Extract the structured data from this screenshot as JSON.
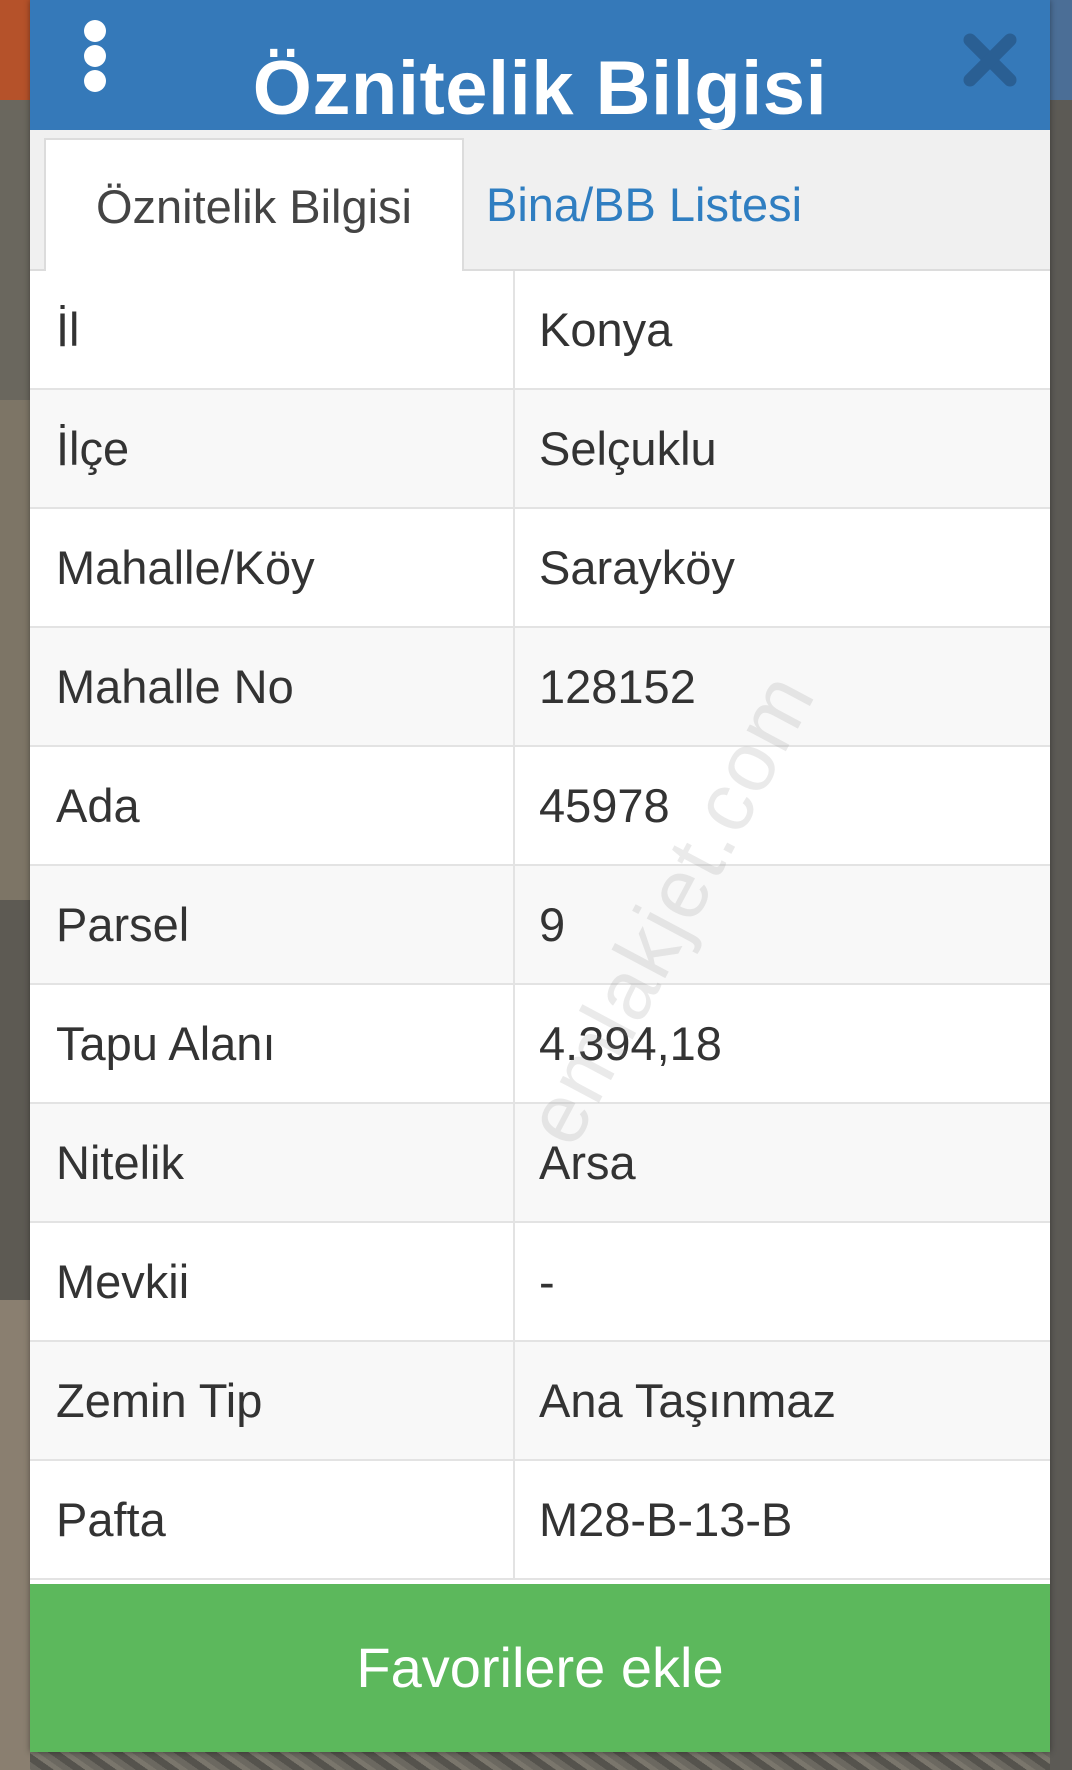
{
  "header": {
    "title": "Öznitelik Bilgisi",
    "menu_icon": "more-vertical-icon",
    "close_icon": "close-icon",
    "color": "#3579b9"
  },
  "tabs": [
    {
      "label": "Öznitelik Bilgisi",
      "active": true
    },
    {
      "label": "Bina/BB Listesi",
      "active": false
    }
  ],
  "attributes": [
    {
      "label": "İl",
      "value": "Konya"
    },
    {
      "label": "İlçe",
      "value": "Selçuklu"
    },
    {
      "label": "Mahalle/Köy",
      "value": "Sarayköy"
    },
    {
      "label": "Mahalle No",
      "value": "128152"
    },
    {
      "label": "Ada",
      "value": "45978"
    },
    {
      "label": "Parsel",
      "value": "9"
    },
    {
      "label": "Tapu Alanı",
      "value": "4.394,18"
    },
    {
      "label": "Nitelik",
      "value": "Arsa"
    },
    {
      "label": "Mevkii",
      "value": "-"
    },
    {
      "label": "Zemin Tip",
      "value": "Ana Taşınmaz"
    },
    {
      "label": "Pafta",
      "value": "M28-B-13-B"
    }
  ],
  "footer": {
    "favorite_label": "Favorilere ekle",
    "color": "#5cb85c"
  },
  "watermark": "emlakjet.com"
}
